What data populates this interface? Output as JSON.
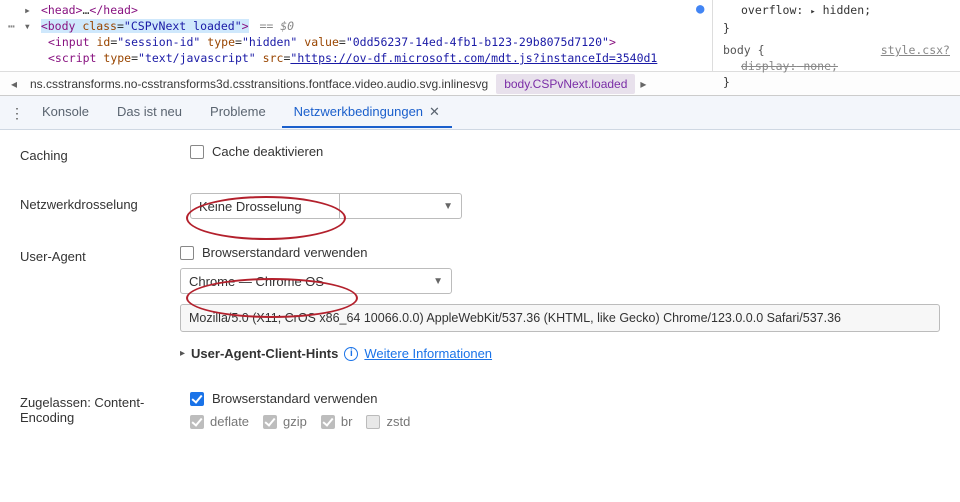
{
  "dom": {
    "line1_head_open": "<head>",
    "line1_head_ell": "…",
    "line1_head_close": "</head>",
    "body_open_prefix": "<body ",
    "body_class_attr": "class",
    "body_class_val": "\"CSPvNext loaded\"",
    "body_open_suffix": ">",
    "body_eq0": " == $0",
    "input_open": "<input ",
    "input_id_attr": "id",
    "input_id_val": "\"session-id\"",
    "input_type_attr": "type",
    "input_type_val": "\"hidden\"",
    "input_value_attr": "value",
    "input_value_val": "\"0dd56237-14ed-4fb1-b123-29b8075d7120\"",
    "input_close": ">",
    "script_open": "<script ",
    "script_type_attr": "type",
    "script_type_val": "\"text/javascript\"",
    "script_src_attr": "src",
    "script_src_val": "\"https://ov-df.microsoft.com/mdt.js?instanceId=3540d1"
  },
  "styles": {
    "overflow_prop": "overflow:",
    "overflow_val": "hidden;",
    "brace_close": "}",
    "body_sel": "body {",
    "style_link": "style.csx?",
    "display_prop": "display:",
    "display_val": "none;"
  },
  "breadcrumb": {
    "long": "ns.csstransforms.no-csstransforms3d.csstransitions.fontface.video.audio.svg.inlinesvg",
    "selected": "body.CSPvNext.loaded"
  },
  "tabs": {
    "konsole": "Konsole",
    "neu": "Das ist neu",
    "probleme": "Probleme",
    "netz": "Netzwerkbedingungen"
  },
  "panel": {
    "caching_label": "Caching",
    "cache_chk": "Cache deaktivieren",
    "throttle_label": "Netzwerkdrosselung",
    "throttle_val": "Keine Drosselung",
    "ua_label": "User-Agent",
    "ua_default_chk": "Browserstandard verwenden",
    "ua_select_val": "Chrome — Chrome OS",
    "ua_string": "Mozilla/5.0 (X11; CrOS x86_64 10066.0.0) AppleWebKit/537.36 (KHTML, like Gecko) Chrome/123.0.0.0 Safari/537.36",
    "hints_label": "User-Agent-Client-Hints",
    "hints_link": "Weitere Informationen",
    "encoding_label": "Zugelassen: Content-Encoding",
    "enc_default": "Browserstandard verwenden",
    "enc_deflate": "deflate",
    "enc_gzip": "gzip",
    "enc_br": "br",
    "enc_zstd": "zstd"
  }
}
